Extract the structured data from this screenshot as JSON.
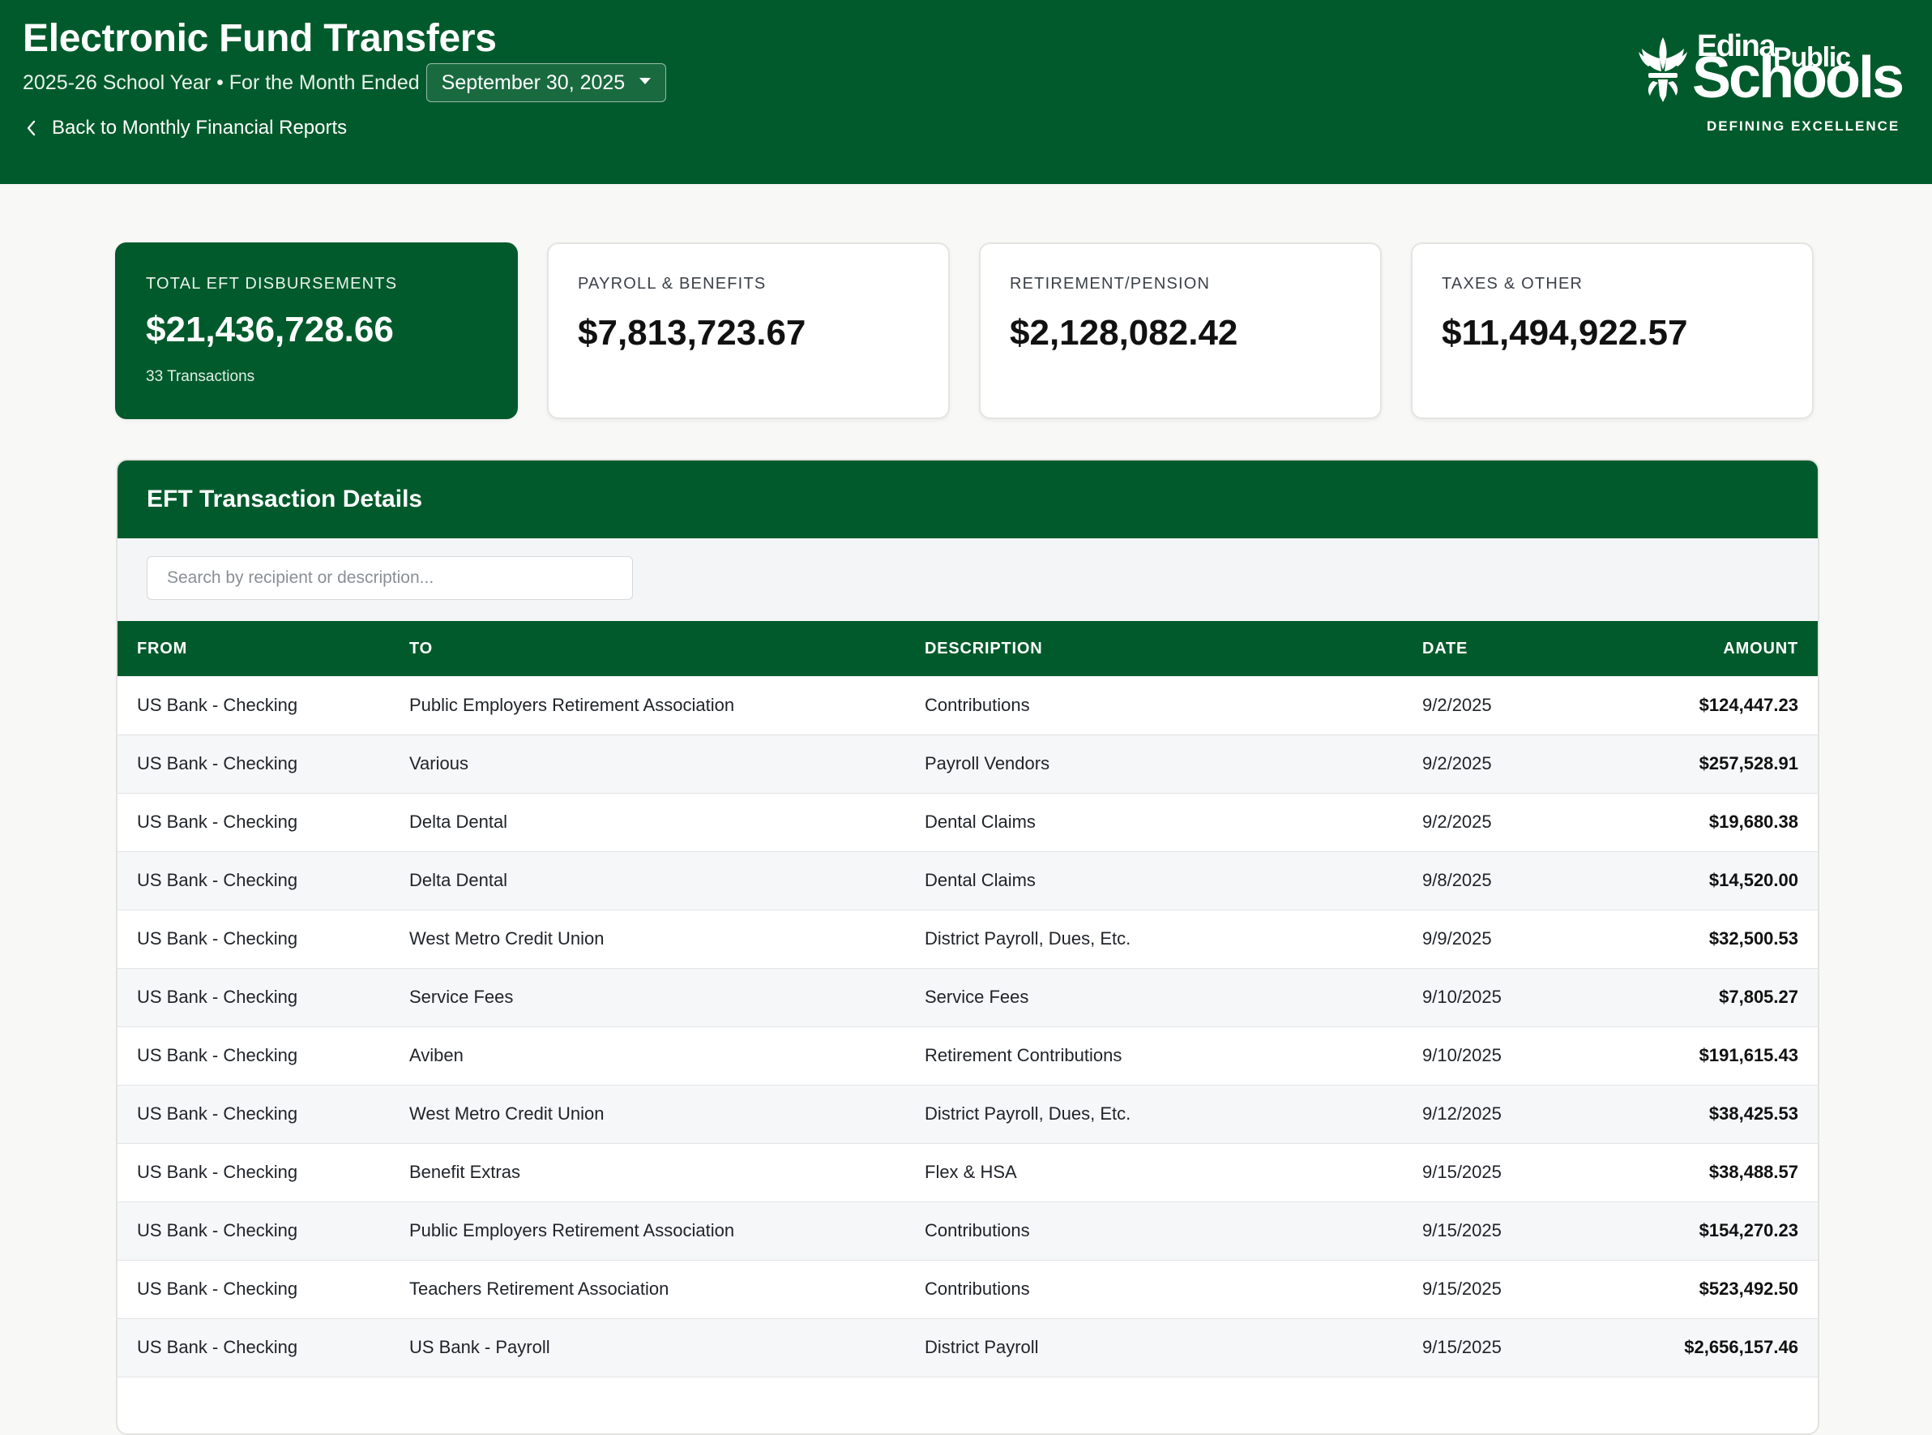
{
  "header": {
    "title": "Electronic Fund Transfers",
    "subtitle": "2025-26 School Year • For the Month Ended",
    "month_selected": "September 30, 2025",
    "back_label": "Back to Monthly Financial Reports",
    "logo": {
      "edina": "Edina",
      "public": "Public",
      "schools": "Schools",
      "tagline": "DEFINING EXCELLENCE"
    }
  },
  "summary": {
    "total": {
      "label": "TOTAL EFT DISBURSEMENTS",
      "value": "$21,436,728.66",
      "sub": "33 Transactions"
    },
    "payroll": {
      "label": "PAYROLL & BENEFITS",
      "value": "$7,813,723.67"
    },
    "retirement": {
      "label": "RETIREMENT/PENSION",
      "value": "$2,128,082.42"
    },
    "taxes": {
      "label": "TAXES & OTHER",
      "value": "$11,494,922.57"
    }
  },
  "details": {
    "title": "EFT Transaction Details",
    "search_placeholder": "Search by recipient or description...",
    "columns": {
      "from": "FROM",
      "to": "TO",
      "description": "DESCRIPTION",
      "date": "DATE",
      "amount": "AMOUNT"
    },
    "rows": [
      {
        "from": "US Bank - Checking",
        "to": "Public Employers Retirement Association",
        "description": "Contributions",
        "date": "9/2/2025",
        "amount": "$124,447.23"
      },
      {
        "from": "US Bank - Checking",
        "to": "Various",
        "description": "Payroll Vendors",
        "date": "9/2/2025",
        "amount": "$257,528.91"
      },
      {
        "from": "US Bank - Checking",
        "to": "Delta Dental",
        "description": "Dental Claims",
        "date": "9/2/2025",
        "amount": "$19,680.38"
      },
      {
        "from": "US Bank - Checking",
        "to": "Delta Dental",
        "description": "Dental Claims",
        "date": "9/8/2025",
        "amount": "$14,520.00"
      },
      {
        "from": "US Bank - Checking",
        "to": "West Metro Credit Union",
        "description": "District Payroll, Dues, Etc.",
        "date": "9/9/2025",
        "amount": "$32,500.53"
      },
      {
        "from": "US Bank - Checking",
        "to": "Service Fees",
        "description": "Service Fees",
        "date": "9/10/2025",
        "amount": "$7,805.27"
      },
      {
        "from": "US Bank - Checking",
        "to": "Aviben",
        "description": "Retirement Contributions",
        "date": "9/10/2025",
        "amount": "$191,615.43"
      },
      {
        "from": "US Bank - Checking",
        "to": "West Metro Credit Union",
        "description": "District Payroll, Dues, Etc.",
        "date": "9/12/2025",
        "amount": "$38,425.53"
      },
      {
        "from": "US Bank - Checking",
        "to": "Benefit Extras",
        "description": "Flex & HSA",
        "date": "9/15/2025",
        "amount": "$38,488.57"
      },
      {
        "from": "US Bank - Checking",
        "to": "Public Employers Retirement Association",
        "description": "Contributions",
        "date": "9/15/2025",
        "amount": "$154,270.23"
      },
      {
        "from": "US Bank - Checking",
        "to": "Teachers Retirement Association",
        "description": "Contributions",
        "date": "9/15/2025",
        "amount": "$523,492.50"
      },
      {
        "from": "US Bank - Checking",
        "to": "US Bank - Payroll",
        "description": "District Payroll",
        "date": "9/15/2025",
        "amount": "$2,656,157.46"
      }
    ]
  }
}
